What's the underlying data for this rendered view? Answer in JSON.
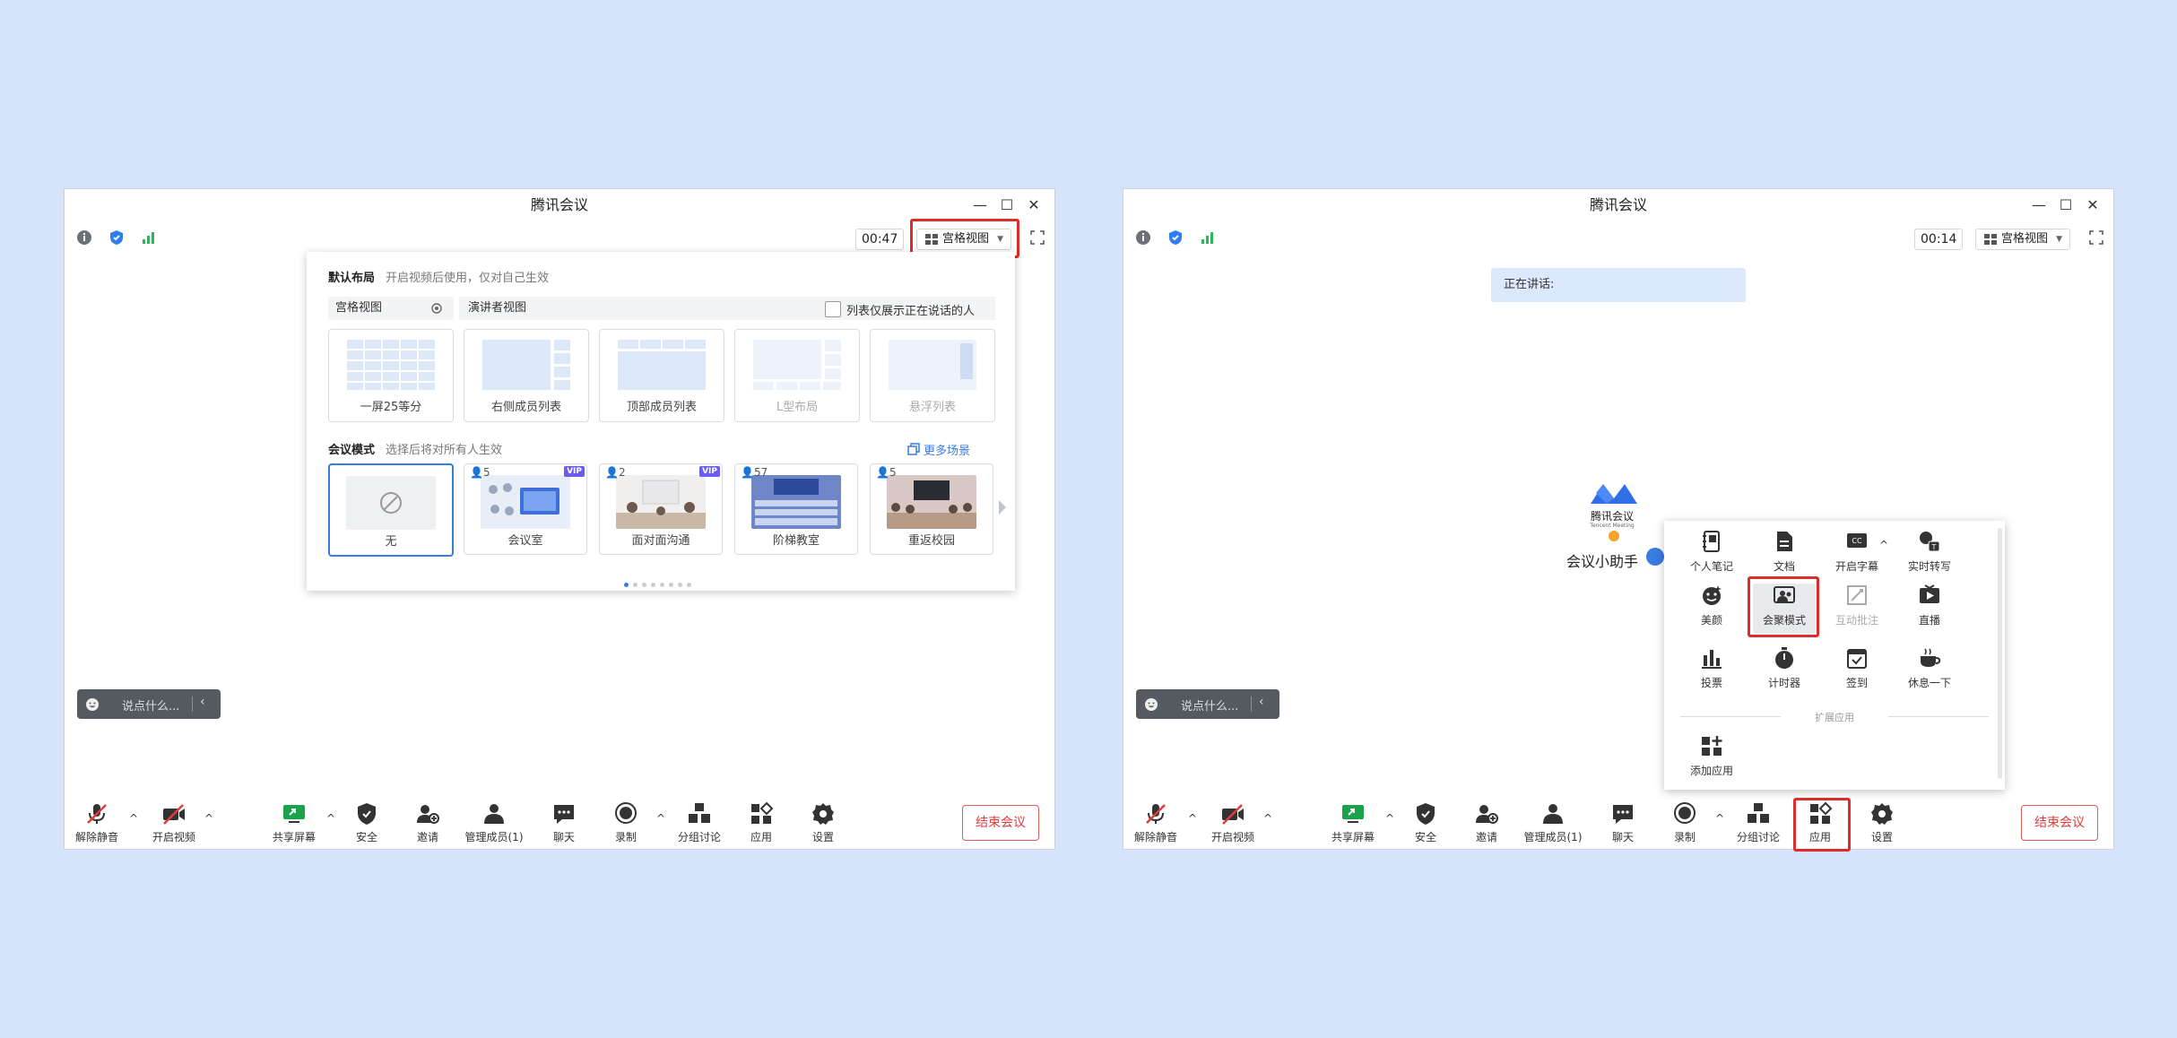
{
  "window": {
    "title": "腾讯会议",
    "minimize": "—",
    "maximize": "☐",
    "close": "✕"
  },
  "left": {
    "timer": "00:47",
    "view_button": "宫格视图",
    "popup": {
      "default_layout": {
        "title": "默认布局",
        "hint": "开启视频后使用，仅对自己生效"
      },
      "tabs": [
        "宫格视图",
        "演讲者视图"
      ],
      "list_checkbox": "列表仅展示正在说话的人",
      "layouts": [
        "一屏25等分",
        "右侧成员列表",
        "顶部成员列表",
        "L型布局",
        "悬浮列表"
      ],
      "scene_mode": {
        "title": "会议模式",
        "hint": "选择后将对所有人生效",
        "more": "更多场景"
      },
      "scenes": [
        {
          "label": "无",
          "count": "",
          "vip": ""
        },
        {
          "label": "会议室",
          "count": "5",
          "vip": "VIP"
        },
        {
          "label": "面对面沟通",
          "count": "2",
          "vip": "VIP"
        },
        {
          "label": "阶梯教室",
          "count": "57",
          "vip": ""
        },
        {
          "label": "重返校园",
          "count": "5",
          "vip": ""
        }
      ]
    }
  },
  "right": {
    "timer": "00:14",
    "view_button": "宫格视图",
    "speaking": "正在讲话:",
    "app_logo_name": "腾讯会议",
    "app_logo_sub": "Tencent Meeting",
    "assistant": "会议小助手",
    "apps": [
      {
        "label": "个人笔记",
        "icon": "note-icon"
      },
      {
        "label": "文档",
        "icon": "document-icon"
      },
      {
        "label": "开启字幕",
        "icon": "caption-icon"
      },
      {
        "label": "实时转写",
        "icon": "transcribe-icon"
      },
      {
        "label": "美颜",
        "icon": "beauty-icon"
      },
      {
        "label": "会聚模式",
        "icon": "gather-mode-icon"
      },
      {
        "label": "互动批注",
        "icon": "annotation-icon"
      },
      {
        "label": "直播",
        "icon": "live-icon"
      },
      {
        "label": "投票",
        "icon": "vote-icon"
      },
      {
        "label": "计时器",
        "icon": "timer-icon"
      },
      {
        "label": "签到",
        "icon": "checkin-icon"
      },
      {
        "label": "休息一下",
        "icon": "coffee-icon"
      }
    ],
    "ext_title": "扩展应用",
    "add_app": "添加应用"
  },
  "chat_placeholder": "说点什么...",
  "toolbar": {
    "unmute": "解除静音",
    "start_video": "开启视频",
    "share": "共享屏幕",
    "security": "安全",
    "invite": "邀请",
    "members": "管理成员(1)",
    "chat": "聊天",
    "record": "录制",
    "breakout": "分组讨论",
    "apps": "应用",
    "settings": "设置",
    "end": "结束会议"
  },
  "colors": {
    "accent": "#3a7be0",
    "highlight_border": "#e02b2b",
    "background": "#d6e3fb"
  }
}
